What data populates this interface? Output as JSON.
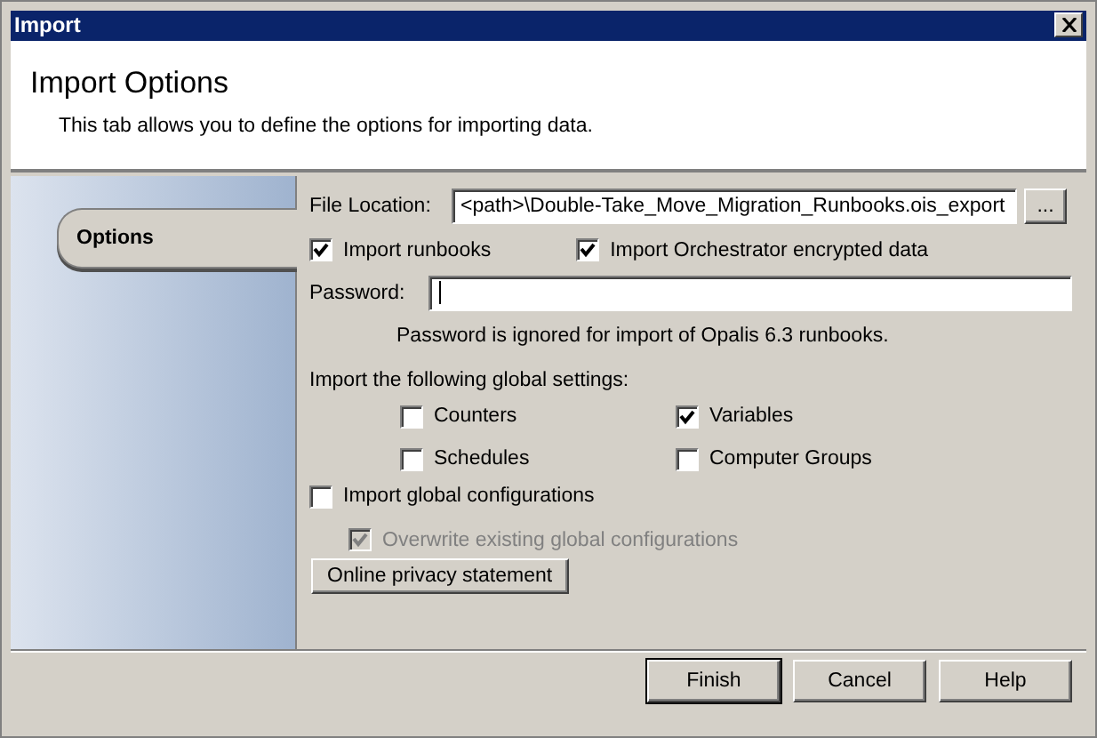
{
  "window": {
    "title": "Import"
  },
  "header": {
    "title": "Import Options",
    "description": "This tab allows you to define the options for importing data."
  },
  "tabs": [
    {
      "label": "Options",
      "selected": true
    }
  ],
  "file_location": {
    "label": "File Location:",
    "value": "<path>\\Double-Take_Move_Migration_Runbooks.ois_export",
    "browse": "..."
  },
  "import_options": [
    {
      "label": "Import runbooks",
      "checked": true
    },
    {
      "label": "Import Orchestrator encrypted data",
      "checked": true
    }
  ],
  "password": {
    "label": "Password:",
    "note": "Password is ignored for import of Opalis 6.3 runbooks."
  },
  "global_settings": {
    "label": "Import the following global settings:",
    "items": [
      {
        "label": "Counters",
        "checked": false
      },
      {
        "label": "Variables",
        "checked": true
      },
      {
        "label": "Schedules",
        "checked": false
      },
      {
        "label": "Computer Groups",
        "checked": false
      }
    ]
  },
  "global_configurations": {
    "label": "Import global configurations",
    "checked": false
  },
  "overwrite": {
    "label": "Overwrite existing global configurations",
    "checked": true,
    "disabled": true
  },
  "privacy_button": "Online privacy statement",
  "buttons": [
    {
      "label": "Finish",
      "default": true
    },
    {
      "label": "Cancel",
      "default": false
    },
    {
      "label": "Help",
      "default": false
    }
  ]
}
